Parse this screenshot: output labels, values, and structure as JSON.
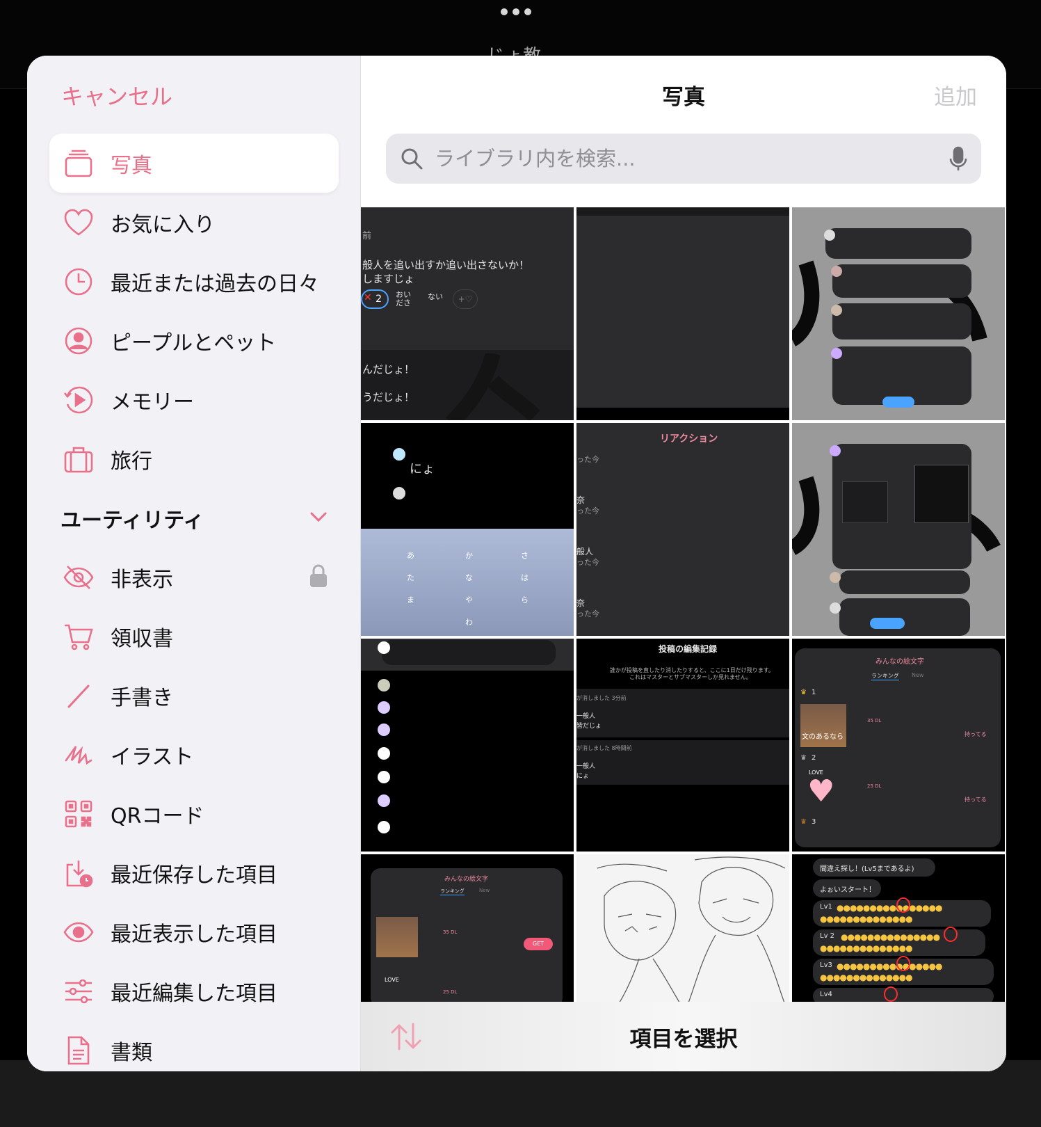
{
  "background": {
    "title_partial": "じょ教"
  },
  "sidebar": {
    "cancel_label": "キャンセル",
    "items": [
      {
        "label": "写真",
        "icon": "photos-stack-icon",
        "selected": true
      },
      {
        "label": "お気に入り",
        "icon": "heart-icon"
      },
      {
        "label": "最近または過去の日々",
        "icon": "clock-icon"
      },
      {
        "label": "ピープルとペット",
        "icon": "person-circle-icon"
      },
      {
        "label": "メモリー",
        "icon": "memories-play-icon"
      },
      {
        "label": "旅行",
        "icon": "suitcase-icon"
      }
    ],
    "utilities": {
      "label": "ユーティリティ",
      "items": [
        {
          "label": "非表示",
          "icon": "eye-slash-icon",
          "locked": true
        },
        {
          "label": "領収書",
          "icon": "cart-icon"
        },
        {
          "label": "手書き",
          "icon": "pencil-icon"
        },
        {
          "label": "イラスト",
          "icon": "scribble-icon"
        },
        {
          "label": "QRコード",
          "icon": "qr-code-icon"
        },
        {
          "label": "最近保存した項目",
          "icon": "download-clock-icon"
        },
        {
          "label": "最近表示した項目",
          "icon": "eye-icon"
        },
        {
          "label": "最近編集した項目",
          "icon": "sliders-icon"
        },
        {
          "label": "書類",
          "icon": "document-icon"
        }
      ]
    }
  },
  "main": {
    "title": "写真",
    "add_label": "追加",
    "search_placeholder": "ライブラリ内を検索...",
    "select_label": "項目を選択",
    "thumbs": {
      "t1": {
        "line1": "前",
        "line2": "般人を追い出すか追い出さないか！",
        "line3": "しますじょ",
        "badge": "2",
        "opt1": "おい\nださ",
        "opt2": "ない",
        "line4": "んだじょ！",
        "line5": "うだじょ！"
      },
      "t4": {
        "name": "にょ"
      },
      "t5": {
        "title": "リアクション",
        "r1": "った今",
        "r2": "奈",
        "r3": "った今",
        "r4": "般人",
        "r5": "った今",
        "r6": "奈",
        "r7": "った今"
      },
      "t8": {
        "title": "投稿の編集記録",
        "desc": "誰かが投稿を直したり消したりすると、ここに1日だけ残ります。",
        "desc2": "これはマスターとサブマスターしか見れません。",
        "e1": "が消しました 3分前",
        "e2": "一般人",
        "e3": "皆だじょ",
        "e4": "が消しました 8時間前",
        "e5": "一般人",
        "e6": "にょ"
      },
      "t9": {
        "title": "みんなの絵文字",
        "tab1": "ランキング",
        "tab2": "New",
        "rank1": "1",
        "rank2": "2",
        "rank3": "3",
        "dl1": "35 DL",
        "dl2": "25 DL",
        "action": "持ってる",
        "img_caption": "文のあるなら",
        "love": "LOVE"
      },
      "t10": {
        "title": "みんなの絵文字",
        "tab1": "ランキング",
        "tab2": "New",
        "dl1": "35 DL",
        "dl2": "25 DL",
        "get": "GET",
        "love": "LOVE"
      },
      "t12": {
        "b1": "間違え探し！(Lv5まであるよ)",
        "b2": "よぉいスタート！",
        "l1": "Lv1",
        "l2": "Lv 2",
        "l3": "Lv3",
        "l4": "Lv4"
      }
    }
  },
  "colors": {
    "accent": "#e8708a",
    "sidebar_bg": "#f2f1f6",
    "search_bg": "#e7e7ec"
  }
}
